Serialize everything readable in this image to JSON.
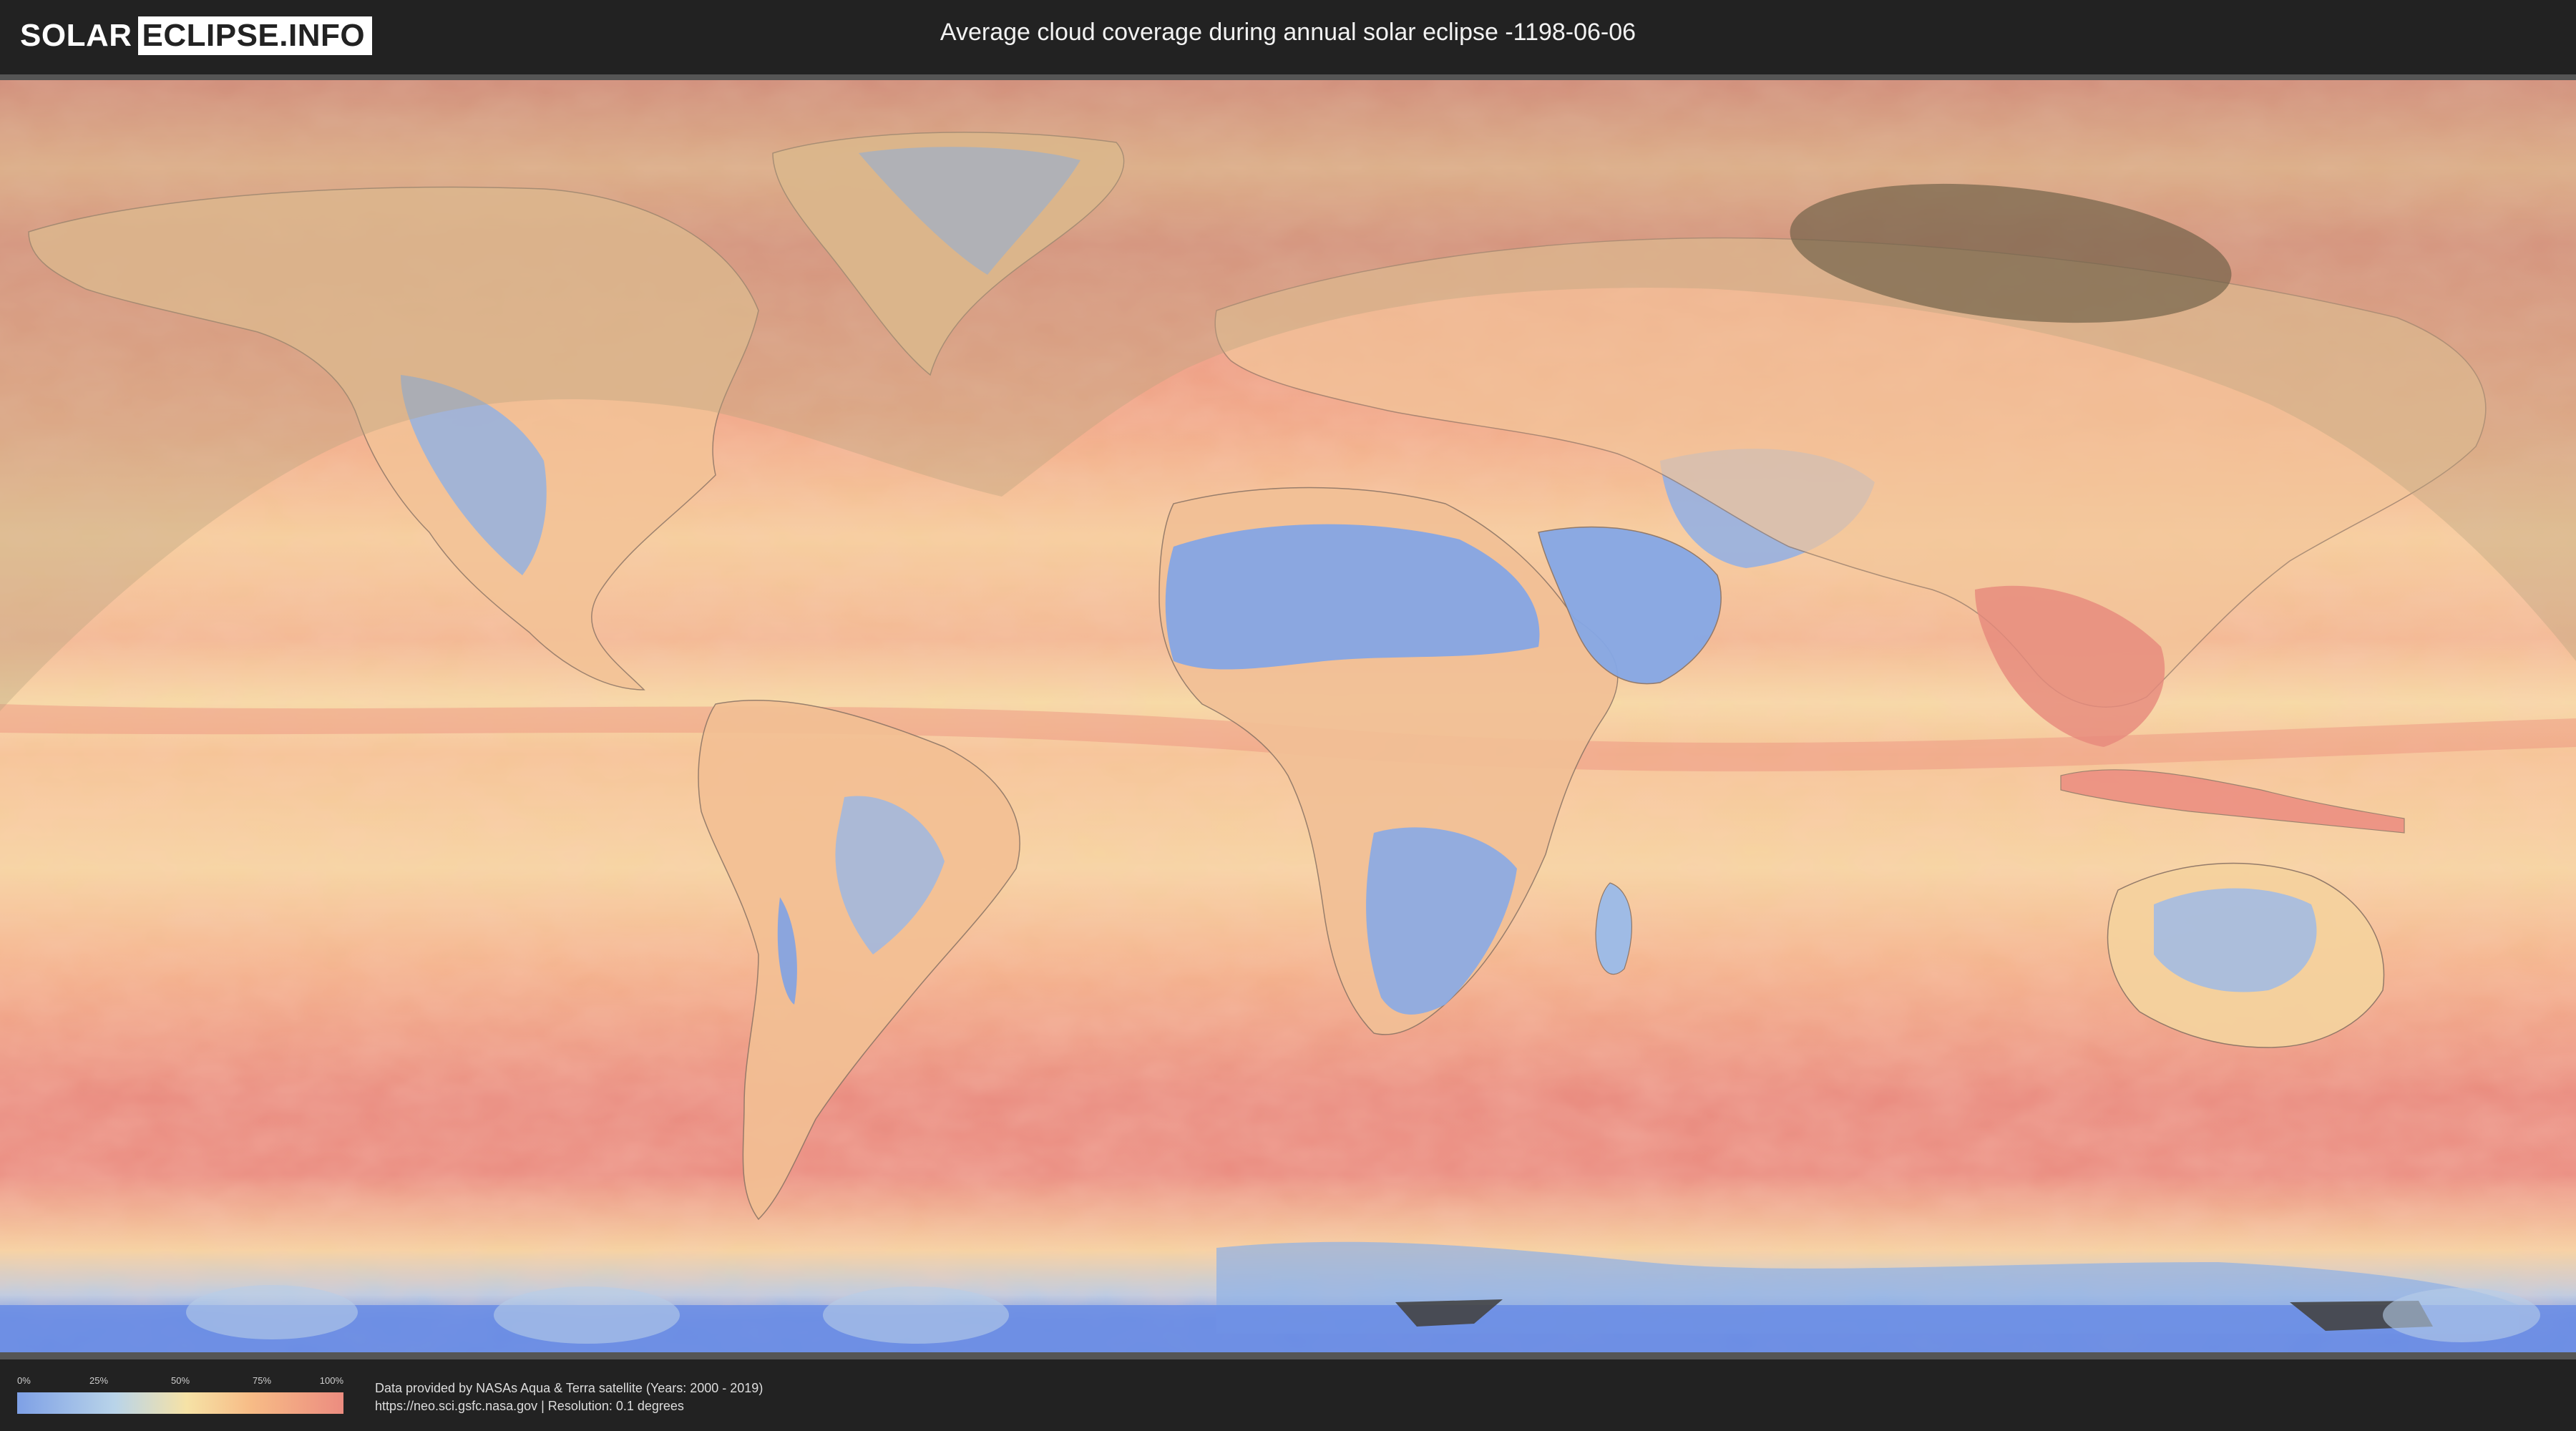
{
  "header": {
    "logo_left": "SOLAR",
    "logo_right": "ECLIPSE.INFO",
    "title": "Average cloud coverage during annual solar eclipse -1198-06-06"
  },
  "legend": {
    "ticks": [
      "0%",
      "25%",
      "50%",
      "75%",
      "100%"
    ],
    "gradient_colors": [
      "#7ea0e6",
      "#b9d4e9",
      "#f6e2a6",
      "#f7bb86",
      "#ec8c80"
    ]
  },
  "credits": {
    "line1": "Data provided by NASAs Aqua & Terra satellite (Years: 2000 - 2019)",
    "line2": "https://neo.sci.gsfc.nasa.gov | Resolution: 0.1 degrees"
  },
  "map": {
    "kind": "world cloud coverage map",
    "overlays": [
      "eclipse-visibility-shade",
      "annularity-path-ellipse"
    ]
  },
  "colors": {
    "background": "#222222",
    "clear_sky": "#7ea0e6",
    "full_cloud": "#ec8c80"
  }
}
